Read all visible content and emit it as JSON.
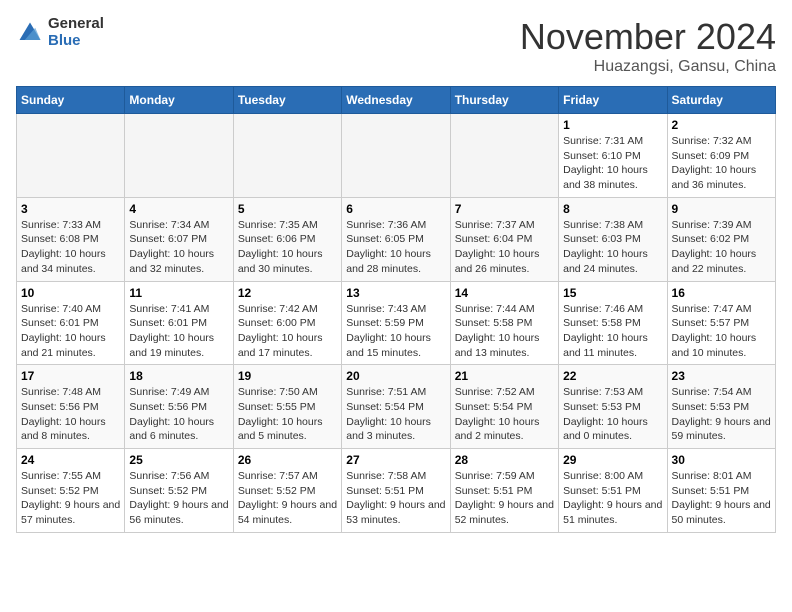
{
  "header": {
    "logo_general": "General",
    "logo_blue": "Blue",
    "month_title": "November 2024",
    "location": "Huazangsi, Gansu, China"
  },
  "weekdays": [
    "Sunday",
    "Monday",
    "Tuesday",
    "Wednesday",
    "Thursday",
    "Friday",
    "Saturday"
  ],
  "weeks": [
    [
      {
        "day": "",
        "info": ""
      },
      {
        "day": "",
        "info": ""
      },
      {
        "day": "",
        "info": ""
      },
      {
        "day": "",
        "info": ""
      },
      {
        "day": "",
        "info": ""
      },
      {
        "day": "1",
        "info": "Sunrise: 7:31 AM\nSunset: 6:10 PM\nDaylight: 10 hours and 38 minutes."
      },
      {
        "day": "2",
        "info": "Sunrise: 7:32 AM\nSunset: 6:09 PM\nDaylight: 10 hours and 36 minutes."
      }
    ],
    [
      {
        "day": "3",
        "info": "Sunrise: 7:33 AM\nSunset: 6:08 PM\nDaylight: 10 hours and 34 minutes."
      },
      {
        "day": "4",
        "info": "Sunrise: 7:34 AM\nSunset: 6:07 PM\nDaylight: 10 hours and 32 minutes."
      },
      {
        "day": "5",
        "info": "Sunrise: 7:35 AM\nSunset: 6:06 PM\nDaylight: 10 hours and 30 minutes."
      },
      {
        "day": "6",
        "info": "Sunrise: 7:36 AM\nSunset: 6:05 PM\nDaylight: 10 hours and 28 minutes."
      },
      {
        "day": "7",
        "info": "Sunrise: 7:37 AM\nSunset: 6:04 PM\nDaylight: 10 hours and 26 minutes."
      },
      {
        "day": "8",
        "info": "Sunrise: 7:38 AM\nSunset: 6:03 PM\nDaylight: 10 hours and 24 minutes."
      },
      {
        "day": "9",
        "info": "Sunrise: 7:39 AM\nSunset: 6:02 PM\nDaylight: 10 hours and 22 minutes."
      }
    ],
    [
      {
        "day": "10",
        "info": "Sunrise: 7:40 AM\nSunset: 6:01 PM\nDaylight: 10 hours and 21 minutes."
      },
      {
        "day": "11",
        "info": "Sunrise: 7:41 AM\nSunset: 6:01 PM\nDaylight: 10 hours and 19 minutes."
      },
      {
        "day": "12",
        "info": "Sunrise: 7:42 AM\nSunset: 6:00 PM\nDaylight: 10 hours and 17 minutes."
      },
      {
        "day": "13",
        "info": "Sunrise: 7:43 AM\nSunset: 5:59 PM\nDaylight: 10 hours and 15 minutes."
      },
      {
        "day": "14",
        "info": "Sunrise: 7:44 AM\nSunset: 5:58 PM\nDaylight: 10 hours and 13 minutes."
      },
      {
        "day": "15",
        "info": "Sunrise: 7:46 AM\nSunset: 5:58 PM\nDaylight: 10 hours and 11 minutes."
      },
      {
        "day": "16",
        "info": "Sunrise: 7:47 AM\nSunset: 5:57 PM\nDaylight: 10 hours and 10 minutes."
      }
    ],
    [
      {
        "day": "17",
        "info": "Sunrise: 7:48 AM\nSunset: 5:56 PM\nDaylight: 10 hours and 8 minutes."
      },
      {
        "day": "18",
        "info": "Sunrise: 7:49 AM\nSunset: 5:56 PM\nDaylight: 10 hours and 6 minutes."
      },
      {
        "day": "19",
        "info": "Sunrise: 7:50 AM\nSunset: 5:55 PM\nDaylight: 10 hours and 5 minutes."
      },
      {
        "day": "20",
        "info": "Sunrise: 7:51 AM\nSunset: 5:54 PM\nDaylight: 10 hours and 3 minutes."
      },
      {
        "day": "21",
        "info": "Sunrise: 7:52 AM\nSunset: 5:54 PM\nDaylight: 10 hours and 2 minutes."
      },
      {
        "day": "22",
        "info": "Sunrise: 7:53 AM\nSunset: 5:53 PM\nDaylight: 10 hours and 0 minutes."
      },
      {
        "day": "23",
        "info": "Sunrise: 7:54 AM\nSunset: 5:53 PM\nDaylight: 9 hours and 59 minutes."
      }
    ],
    [
      {
        "day": "24",
        "info": "Sunrise: 7:55 AM\nSunset: 5:52 PM\nDaylight: 9 hours and 57 minutes."
      },
      {
        "day": "25",
        "info": "Sunrise: 7:56 AM\nSunset: 5:52 PM\nDaylight: 9 hours and 56 minutes."
      },
      {
        "day": "26",
        "info": "Sunrise: 7:57 AM\nSunset: 5:52 PM\nDaylight: 9 hours and 54 minutes."
      },
      {
        "day": "27",
        "info": "Sunrise: 7:58 AM\nSunset: 5:51 PM\nDaylight: 9 hours and 53 minutes."
      },
      {
        "day": "28",
        "info": "Sunrise: 7:59 AM\nSunset: 5:51 PM\nDaylight: 9 hours and 52 minutes."
      },
      {
        "day": "29",
        "info": "Sunrise: 8:00 AM\nSunset: 5:51 PM\nDaylight: 9 hours and 51 minutes."
      },
      {
        "day": "30",
        "info": "Sunrise: 8:01 AM\nSunset: 5:51 PM\nDaylight: 9 hours and 50 minutes."
      }
    ]
  ]
}
